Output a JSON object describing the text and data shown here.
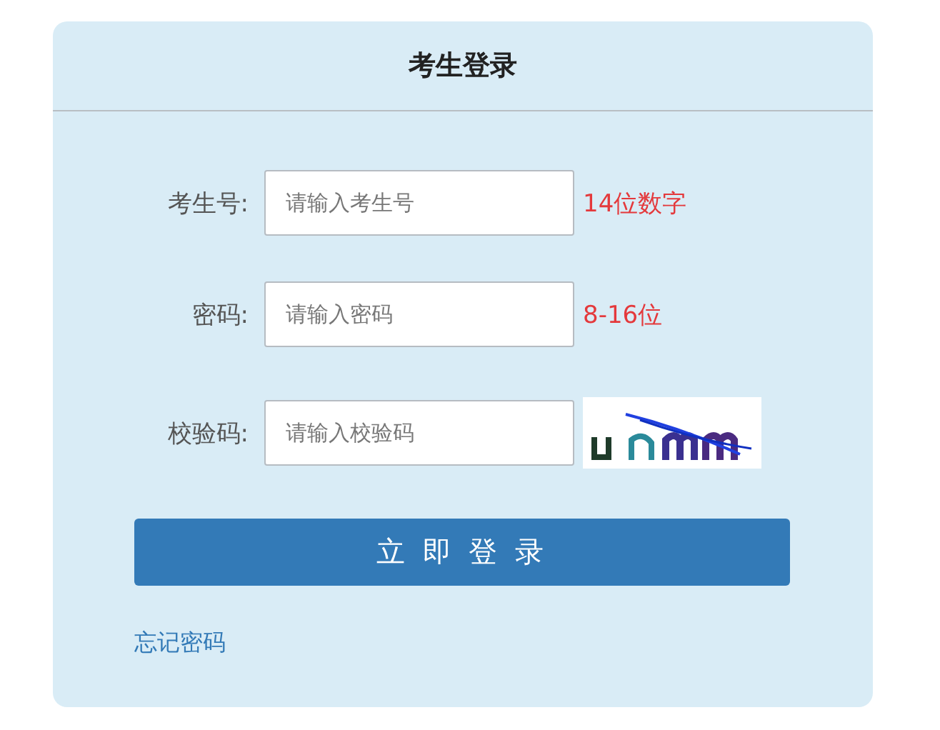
{
  "panel": {
    "title": "考生登录"
  },
  "fields": [
    {
      "kind": "text",
      "label": "考生号:",
      "placeholder": "请输入考生号",
      "hint": "14位数字"
    },
    {
      "kind": "text",
      "label": "密码:",
      "placeholder": "请输入密码",
      "hint": "8-16位"
    },
    {
      "kind": "captcha",
      "label": "校验码:",
      "placeholder": "请输入校验码"
    }
  ],
  "submit": "立 即 登 录",
  "link": "忘记密码"
}
